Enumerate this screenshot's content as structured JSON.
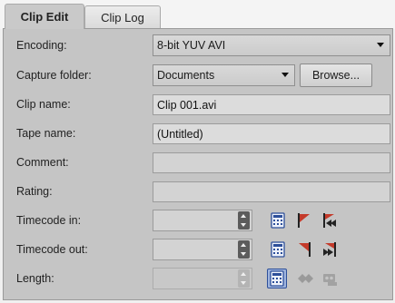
{
  "tabs": [
    {
      "label": "Clip Edit",
      "active": true
    },
    {
      "label": "Clip Log",
      "active": false
    }
  ],
  "encoding": {
    "label": "Encoding:",
    "value": "8-bit YUV AVI"
  },
  "capture_folder": {
    "label": "Capture folder:",
    "value": "Documents",
    "browse_label": "Browse..."
  },
  "clip_name": {
    "label": "Clip name:",
    "value": "Clip 001.avi"
  },
  "tape_name": {
    "label": "Tape name:",
    "value": "(Untitled)"
  },
  "comment": {
    "label": "Comment:",
    "value": ""
  },
  "rating": {
    "label": "Rating:",
    "value": ""
  },
  "timecode_in": {
    "label": "Timecode in:",
    "value": ""
  },
  "timecode_out": {
    "label": "Timecode out:",
    "value": ""
  },
  "length": {
    "label": "Length:",
    "value": ""
  },
  "icons": {
    "timecode_in": [
      "timecode-calc-icon",
      "mark-in-flag-icon",
      "go-to-in-icon"
    ],
    "timecode_out": [
      "timecode-calc-icon",
      "mark-out-flag-icon",
      "go-to-out-icon"
    ],
    "length": [
      "timecode-calc-icon",
      "diamond-icon",
      "tape-icon"
    ]
  },
  "colors": {
    "accent": "#1e4fa8",
    "flag_red": "#c43a2a",
    "panel_bg": "#c5c5c5"
  }
}
